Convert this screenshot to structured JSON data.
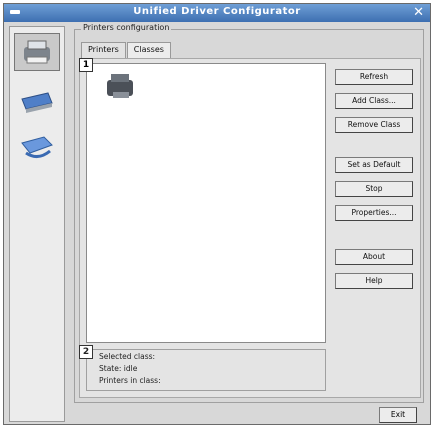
{
  "window": {
    "title": "Unified Driver Configurator",
    "close_glyph": "✕"
  },
  "sidebar": {
    "items": [
      {
        "name": "printers-configuration",
        "icon": "printer-icon",
        "active": true
      },
      {
        "name": "scanners-configuration",
        "icon": "scanner-icon",
        "active": false
      },
      {
        "name": "ports-configuration",
        "icon": "port-icon",
        "active": false
      }
    ]
  },
  "group": {
    "legend": "Printers configuration"
  },
  "tabs": [
    {
      "label": "Printers",
      "active": false
    },
    {
      "label": "Classes",
      "active": true
    }
  ],
  "callouts": {
    "one": "1",
    "two": "2"
  },
  "info": {
    "selected_class": "Selected class:",
    "state": "State: idle",
    "printers_in_class": "Printers in class:"
  },
  "buttons": {
    "refresh": "Refresh",
    "add_class": "Add Class...",
    "remove_class": "Remove Class",
    "set_default": "Set as Default",
    "stop": "Stop",
    "properties": "Properties...",
    "about": "About",
    "help": "Help"
  },
  "footer": {
    "exit": "Exit"
  }
}
